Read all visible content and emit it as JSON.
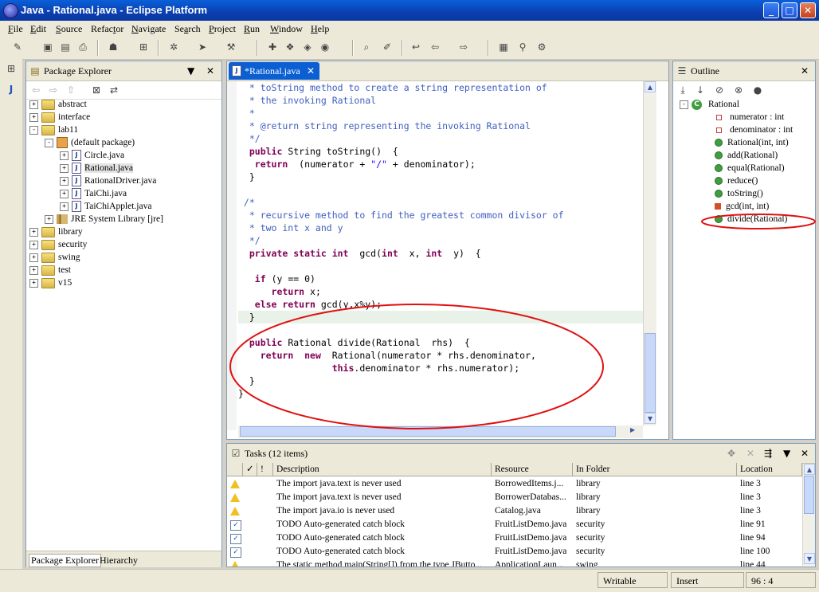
{
  "window": {
    "title": "Java - Rational.java - Eclipse Platform",
    "min": "_",
    "max": "□",
    "close": "✕"
  },
  "menu": [
    {
      "label": "File",
      "key": "F"
    },
    {
      "label": "Edit",
      "key": "E"
    },
    {
      "label": "Source",
      "key": "S"
    },
    {
      "label": "Refactor",
      "key": "t"
    },
    {
      "label": "Navigate",
      "key": "N"
    },
    {
      "label": "Search",
      "key": "a"
    },
    {
      "label": "Project",
      "key": "P"
    },
    {
      "label": "Run",
      "key": "R"
    },
    {
      "label": "Window",
      "key": "W"
    },
    {
      "label": "Help",
      "key": "H"
    }
  ],
  "package_explorer": {
    "title": "Package Explorer",
    "items": [
      {
        "label": "abstract",
        "type": "folder",
        "depth": 0,
        "exp": "+"
      },
      {
        "label": "interface",
        "type": "folder",
        "depth": 0,
        "exp": "+"
      },
      {
        "label": "lab11",
        "type": "folder",
        "depth": 0,
        "exp": "-"
      },
      {
        "label": "(default package)",
        "type": "pkg",
        "depth": 1,
        "exp": "-"
      },
      {
        "label": "Circle.java",
        "type": "java",
        "depth": 2,
        "exp": "+"
      },
      {
        "label": "Rational.java",
        "type": "java",
        "depth": 2,
        "exp": "+",
        "selected": true
      },
      {
        "label": "RationalDriver.java",
        "type": "java",
        "depth": 2,
        "exp": "+"
      },
      {
        "label": "TaiChi.java",
        "type": "java",
        "depth": 2,
        "exp": "+"
      },
      {
        "label": "TaiChiApplet.java",
        "type": "java",
        "depth": 2,
        "exp": "+"
      },
      {
        "label": "JRE System Library [jre]",
        "type": "lib",
        "depth": 1,
        "exp": "+"
      },
      {
        "label": "library",
        "type": "folder",
        "depth": 0,
        "exp": "+"
      },
      {
        "label": "security",
        "type": "folder",
        "depth": 0,
        "exp": "+"
      },
      {
        "label": "swing",
        "type": "folder",
        "depth": 0,
        "exp": "+"
      },
      {
        "label": "test",
        "type": "folder",
        "depth": 0,
        "exp": "+"
      },
      {
        "label": "v15",
        "type": "folder",
        "depth": 0,
        "exp": "+"
      }
    ],
    "bottom_tabs": [
      "Package Explorer",
      "Hierarchy"
    ]
  },
  "editor": {
    "tab": "*Rational.java",
    "lines": [
      [
        {
          "t": "  * toString method to create a string representation of",
          "c": "cm"
        }
      ],
      [
        {
          "t": "  * the invoking Rational",
          "c": "cm"
        }
      ],
      [
        {
          "t": "  *",
          "c": "cm"
        }
      ],
      [
        {
          "t": "  * @return string representing the invoking Rational",
          "c": "cm"
        }
      ],
      [
        {
          "t": "  */",
          "c": "cm"
        }
      ],
      [
        {
          "t": "  ",
          "c": ""
        },
        {
          "t": "public",
          "c": "kw"
        },
        {
          "t": " String toString()  {",
          "c": ""
        }
      ],
      [
        {
          "t": "   ",
          "c": ""
        },
        {
          "t": "return",
          "c": "kw"
        },
        {
          "t": "  (numerator + ",
          "c": ""
        },
        {
          "t": "\"/\"",
          "c": "st"
        },
        {
          "t": " + denominator);",
          "c": ""
        }
      ],
      [
        {
          "t": "  }",
          "c": ""
        }
      ],
      [
        {
          "t": "",
          "c": ""
        }
      ],
      [
        {
          "t": " /*",
          "c": "cm"
        }
      ],
      [
        {
          "t": "  * recursive method to find the greatest common divisor of",
          "c": "cm"
        }
      ],
      [
        {
          "t": "  * two int x and y",
          "c": "cm"
        }
      ],
      [
        {
          "t": "  */",
          "c": "cm"
        }
      ],
      [
        {
          "t": "  ",
          "c": ""
        },
        {
          "t": "private static int",
          "c": "kw"
        },
        {
          "t": "  gcd(",
          "c": ""
        },
        {
          "t": "int",
          "c": "kw"
        },
        {
          "t": "  x, ",
          "c": ""
        },
        {
          "t": "int",
          "c": "kw"
        },
        {
          "t": "  y)  {",
          "c": ""
        }
      ],
      [
        {
          "t": "",
          "c": ""
        }
      ],
      [
        {
          "t": "   ",
          "c": ""
        },
        {
          "t": "if",
          "c": "kw"
        },
        {
          "t": " (y == 0)",
          "c": ""
        }
      ],
      [
        {
          "t": "      ",
          "c": ""
        },
        {
          "t": "return",
          "c": "kw"
        },
        {
          "t": " x;",
          "c": ""
        }
      ],
      [
        {
          "t": "   ",
          "c": ""
        },
        {
          "t": "else return",
          "c": "kw"
        },
        {
          "t": " gcd(y,x%y);",
          "c": ""
        }
      ],
      [
        {
          "t": "  }",
          "c": ""
        }
      ],
      [
        {
          "t": "",
          "c": ""
        }
      ],
      [
        {
          "t": "  ",
          "c": ""
        },
        {
          "t": "public",
          "c": "kw"
        },
        {
          "t": " Rational divide(Rational  rhs)  {",
          "c": ""
        }
      ],
      [
        {
          "t": "    ",
          "c": ""
        },
        {
          "t": "return",
          "c": "kw"
        },
        {
          "t": "  ",
          "c": ""
        },
        {
          "t": "new",
          "c": "kw"
        },
        {
          "t": "  Rational(numerator * rhs.denominator,",
          "c": ""
        }
      ],
      [
        {
          "t": "                 ",
          "c": ""
        },
        {
          "t": "this",
          "c": "kw"
        },
        {
          "t": ".denominator * rhs.numerator);",
          "c": ""
        }
      ],
      [
        {
          "t": "  }",
          "c": ""
        }
      ],
      [
        {
          "t": "}",
          "c": ""
        }
      ]
    ]
  },
  "outline": {
    "title": "Outline",
    "class_name": "Rational",
    "members": [
      {
        "label": "numerator : int",
        "icon": "field"
      },
      {
        "label": "denominator : int",
        "icon": "field"
      },
      {
        "label": "Rational(int, int)",
        "icon": "method",
        "sup": "c"
      },
      {
        "label": "add(Rational)",
        "icon": "method"
      },
      {
        "label": "equal(Rational)",
        "icon": "method"
      },
      {
        "label": "reduce()",
        "icon": "method"
      },
      {
        "label": "toString()",
        "icon": "method"
      },
      {
        "label": "gcd(int, int)",
        "icon": "private",
        "sup": "S"
      },
      {
        "label": "divide(Rational)",
        "icon": "method"
      }
    ]
  },
  "tasks": {
    "title": "Tasks (12 items)",
    "columns": [
      "✓",
      "!",
      "Description",
      "Resource",
      "In Folder",
      "Location"
    ],
    "rows": [
      {
        "icon": "warn",
        "desc": "The import java.text is never used",
        "res": "BorrowedItems.j...",
        "folder": "library",
        "loc": "line 3"
      },
      {
        "icon": "warn",
        "desc": "The import java.text is never used",
        "res": "BorrowerDatabas...",
        "folder": "library",
        "loc": "line 3"
      },
      {
        "icon": "warn",
        "desc": "The import java.io is never used",
        "res": "Catalog.java",
        "folder": "library",
        "loc": "line 3"
      },
      {
        "icon": "todo",
        "desc": "TODO Auto-generated catch block",
        "res": "FruitListDemo.java",
        "folder": "security",
        "loc": "line 91"
      },
      {
        "icon": "todo",
        "desc": "TODO Auto-generated catch block",
        "res": "FruitListDemo.java",
        "folder": "security",
        "loc": "line 94"
      },
      {
        "icon": "todo",
        "desc": "TODO Auto-generated catch block",
        "res": "FruitListDemo.java",
        "folder": "security",
        "loc": "line 100"
      },
      {
        "icon": "warn",
        "desc": "The static method main(String[]) from the type JButto...",
        "res": "ApplicationLaun...",
        "folder": "swing",
        "loc": "line 44"
      }
    ]
  },
  "status": {
    "writable": "Writable",
    "insert": "Insert",
    "position": "96 : 4"
  },
  "colors": {
    "annotation": "#e01010",
    "title_bar": "#0b3fb0"
  }
}
